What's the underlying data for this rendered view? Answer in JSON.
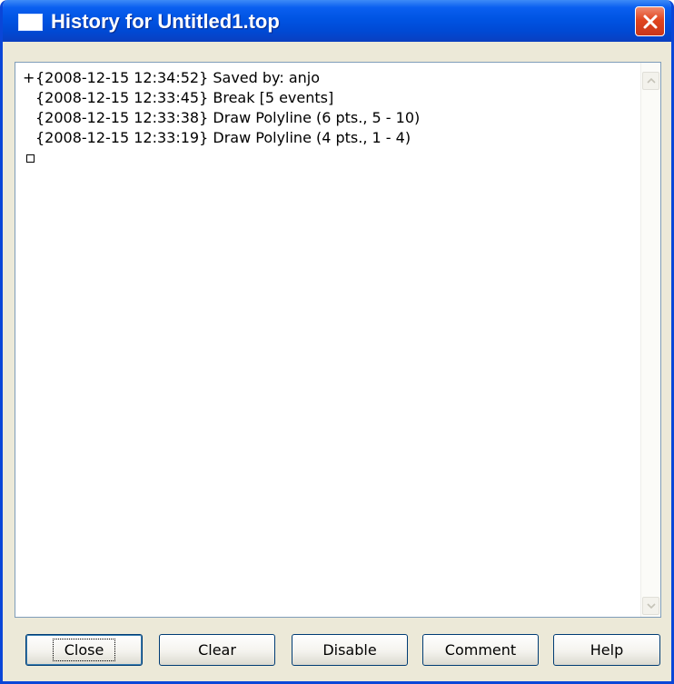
{
  "window": {
    "title": "History for Untitled1.top",
    "close_icon": "close-icon",
    "app_icon": "window-icon"
  },
  "history": {
    "entries": [
      {
        "prefix": "+",
        "text": "{2008-12-15 12:34:52} Saved by: anjo"
      },
      {
        "prefix": "",
        "text": "{2008-12-15 12:33:45} Break [5 events]"
      },
      {
        "prefix": "",
        "text": "{2008-12-15 12:33:38} Draw Polyline (6 pts., 5 - 10)"
      },
      {
        "prefix": "",
        "text": "{2008-12-15 12:33:19} Draw Polyline (4 pts., 1 - 4)"
      }
    ]
  },
  "buttons": {
    "close": "Close",
    "clear": "Clear",
    "disable": "Disable",
    "comment": "Comment",
    "help": "Help"
  },
  "colors": {
    "titlebar": "#0054e3",
    "close_button": "#e0451f",
    "dialog_bg": "#ece9d8"
  }
}
